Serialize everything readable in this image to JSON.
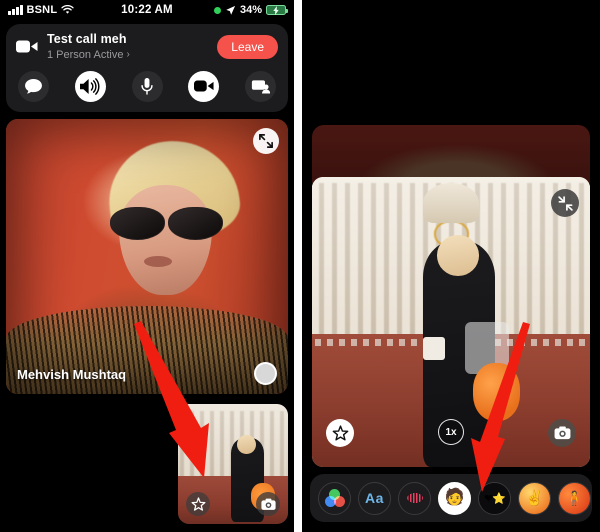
{
  "status_bar": {
    "carrier": "BSNL",
    "time": "10:22 AM",
    "battery_percent": "34%",
    "signal_icon": "signal-bars-icon",
    "wifi_icon": "wifi-icon",
    "recording_icon": "green-recording-dot-icon",
    "location_icon": "location-arrow-icon",
    "battery_icon": "battery-charging-icon"
  },
  "call_header": {
    "video_icon": "video-camera-icon",
    "title": "Test call meh",
    "subtitle": "1 Person Active",
    "chevron": "›",
    "leave_label": "Leave",
    "leave_color": "#f4524a"
  },
  "call_controls": [
    {
      "name": "chat-button",
      "icon": "chat-bubble-icon",
      "active": false
    },
    {
      "name": "speaker-button",
      "icon": "speaker-icon",
      "active": true
    },
    {
      "name": "microphone-button",
      "icon": "microphone-icon",
      "active": false
    },
    {
      "name": "camera-button",
      "icon": "video-camera-icon",
      "active": true
    },
    {
      "name": "share-screen-button",
      "icon": "share-screen-icon",
      "active": false
    }
  ],
  "left_panel": {
    "main_video": {
      "participant_name": "Mehvish Mushtaq",
      "expand_icon": "expand-arrows-icon",
      "mute_indicator_icon": "mute-dot-icon"
    },
    "pip": {
      "effects_icon": "star-effects-icon",
      "flip_camera_icon": "camera-flip-icon"
    }
  },
  "right_panel": {
    "video": {
      "shrink_icon": "shrink-arrows-icon",
      "zoom_label": "1x",
      "effects_icon": "star-effects-icon",
      "flip_camera_icon": "camera-flip-icon"
    },
    "effects_tray": [
      {
        "name": "filters-effect",
        "icon": "rgb-circles-icon",
        "label": "",
        "selected": false
      },
      {
        "name": "text-effect",
        "icon": "text-aa-icon",
        "label": "Aa",
        "selected": false
      },
      {
        "name": "shapes-effect",
        "icon": "squiggle-shapes-icon",
        "label": "",
        "selected": false
      },
      {
        "name": "memoji-effect",
        "icon": "memoji-face-icon",
        "label": "🧑",
        "selected": true
      },
      {
        "name": "stickers-effect",
        "icon": "stickers-icon",
        "label": "❤⭐",
        "selected": false
      },
      {
        "name": "emoji-effect",
        "icon": "hand-peace-icon",
        "label": "✌",
        "selected": false
      },
      {
        "name": "more-effects",
        "icon": "more-effects-icon",
        "label": "🧍",
        "selected": false
      }
    ]
  },
  "annotations": {
    "arrow_color": "#f01e10",
    "left_arrow_target": "pip-effects-button",
    "right_arrow_target": "memoji-effect-button"
  }
}
